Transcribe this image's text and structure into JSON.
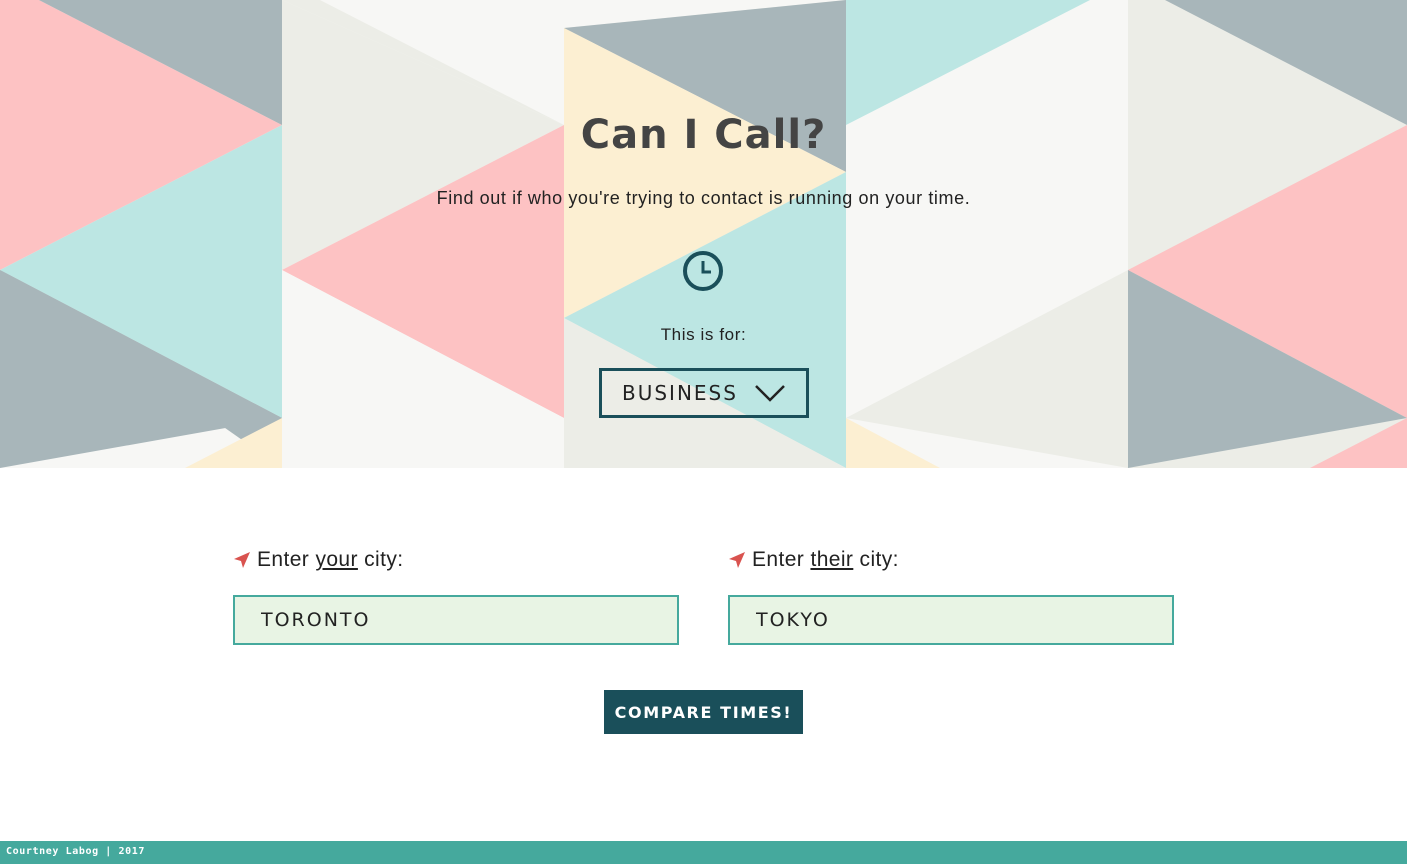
{
  "hero": {
    "title": "Can I Call?",
    "tagline": "Find out if who you're trying to contact is running on your time.",
    "clock_icon": "clock-icon",
    "for_label": "This is for:",
    "select": {
      "value": "BUSINESS",
      "icon": "chevron-down-icon"
    },
    "palette": [
      "#fdc2c3",
      "#bce6e3",
      "#a8b6ba",
      "#ecede7",
      "#f7f7f5",
      "#fcefd2"
    ]
  },
  "form": {
    "your_city": {
      "prefix": "Enter ",
      "emphasis": "your",
      "suffix": " city:",
      "value": "TORONTO",
      "icon": "location-arrow-icon"
    },
    "their_city": {
      "prefix": "Enter ",
      "emphasis": "their",
      "suffix": " city:",
      "value": "TOKYO",
      "icon": "location-arrow-icon"
    },
    "compare_label": "COMPARE TIMES!"
  },
  "footer": {
    "text": "Courtney Labog | 2017"
  },
  "colors": {
    "accent": "#1a4f5a",
    "teal": "#45a99d",
    "input_bg": "#e8f4e4",
    "arrow": "#d9534f"
  }
}
